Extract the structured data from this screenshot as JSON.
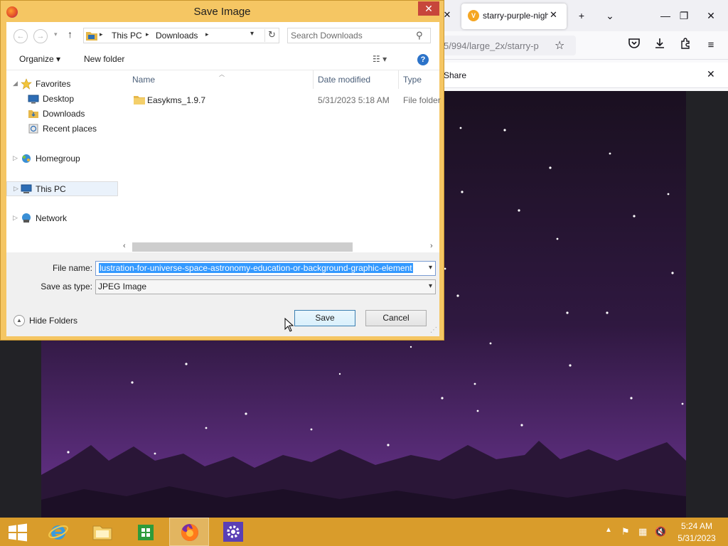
{
  "browser": {
    "tab_title": "starry-purple-night",
    "tab_favicon_letter": "V",
    "url_fragment": "5/994/large_2x/starry-p",
    "notification_label": "Share",
    "close_glyph": "✕",
    "new_tab_glyph": "+",
    "tab_list_glyph": "⌄",
    "min_glyph": "—",
    "max_glyph": "❐",
    "win_close_glyph": "✕"
  },
  "dialog": {
    "title": "Save Image",
    "close_glyph": "✕",
    "address": {
      "back_glyph": "←",
      "forward_glyph": "→",
      "recent_glyph": "▾",
      "up_glyph": "↑",
      "crumbs": [
        "This PC",
        "Downloads"
      ],
      "refresh_glyph": "↻",
      "search_placeholder": "Search Downloads"
    },
    "toolbar": {
      "organize_label": "Organize ▾",
      "new_folder_label": "New folder",
      "view_label": "☷  ▾",
      "help_label": "?"
    },
    "nav": {
      "favorites": "Favorites",
      "desktop": "Desktop",
      "downloads": "Downloads",
      "recent_places": "Recent places",
      "homegroup": "Homegroup",
      "this_pc": "This PC",
      "network": "Network"
    },
    "columns": {
      "name": "Name",
      "date_modified": "Date modified",
      "type": "Type"
    },
    "files": [
      {
        "name": "Easykms_1.9.7",
        "date": "5/31/2023 5:18 AM",
        "type": "File folder"
      }
    ],
    "file_name_label": "File name:",
    "file_name_value": "lustration-for-universe-space-astronomy-education-or-background-graphic-element",
    "save_type_label": "Save as type:",
    "save_type_value": "JPEG Image",
    "hide_folders_label": "Hide Folders",
    "save_button": "Save",
    "cancel_button": "Cancel"
  },
  "taskbar": {
    "time": "5:24 AM",
    "date": "5/31/2023",
    "active_app": "Firefox"
  },
  "colors": {
    "titlebar_accent": "#f5c663",
    "taskbar": "#d99c2b",
    "close_button": "#c7463b",
    "selection": "#3399ff",
    "sky_top": "#2a1436",
    "sky_bottom": "#5d2d7a"
  }
}
